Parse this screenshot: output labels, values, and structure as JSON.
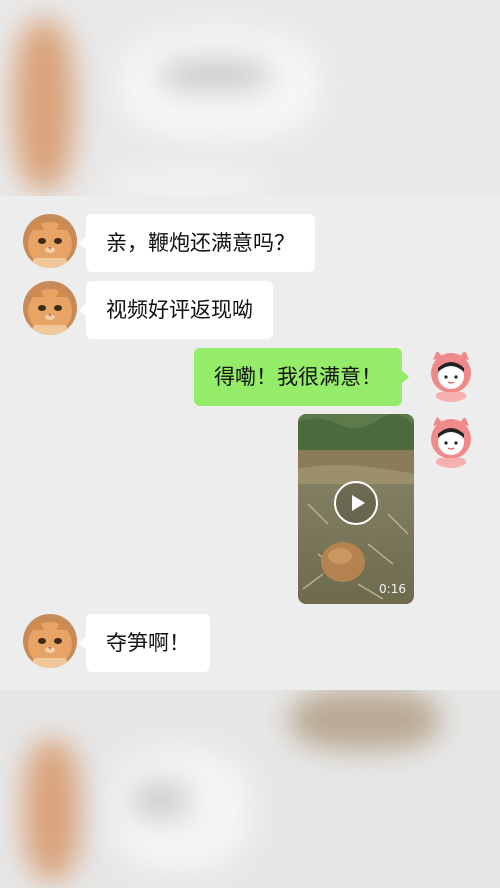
{
  "chat": {
    "messages": [
      {
        "sender": "other",
        "text": "亲，鞭炮还满意吗？"
      },
      {
        "sender": "other",
        "text": "视频好评返现呦"
      },
      {
        "sender": "me",
        "text": "得嘞！我很满意！"
      },
      {
        "sender": "me",
        "type": "video",
        "duration": "0:16"
      },
      {
        "sender": "other",
        "text": "夺笋啊！"
      }
    ]
  },
  "colors": {
    "background": "#ededed",
    "incoming_bubble": "#ffffff",
    "outgoing_bubble": "#95ec69"
  },
  "icons": {
    "other_avatar": "orange-cat-avatar-icon",
    "my_avatar": "pink-pig-hood-avatar-icon",
    "video_control": "play-icon"
  }
}
